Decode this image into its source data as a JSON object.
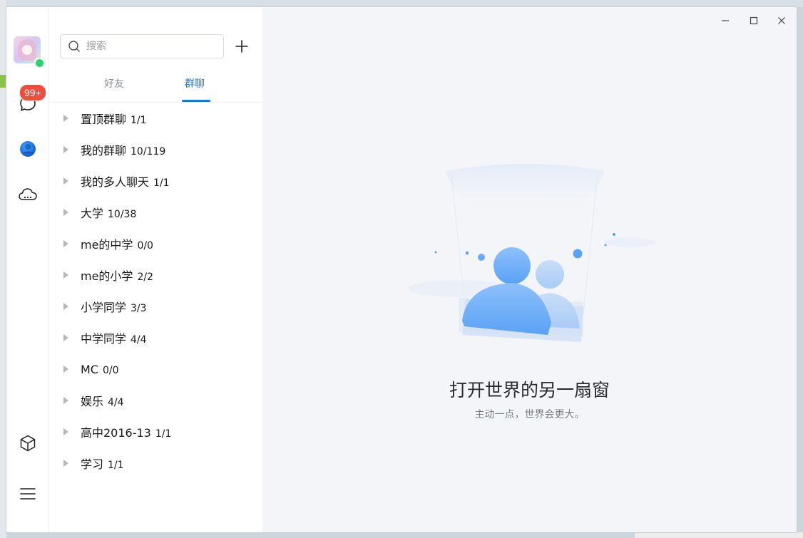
{
  "app": {
    "accent_color": "#1677e6",
    "badge_color": "#f04d3a",
    "online_color": "#2bd46b"
  },
  "rail": {
    "unread_badge": "99+",
    "icons": [
      "chat-bubble-icon",
      "contacts-icon",
      "cloud-icon",
      "cube-icon",
      "menu-icon"
    ]
  },
  "search": {
    "placeholder": "搜索"
  },
  "tabs": {
    "friends": "好友",
    "groups": "群聊",
    "active": "groups"
  },
  "groups": [
    {
      "name": "置顶群聊",
      "count": "1/1"
    },
    {
      "name": "我的群聊",
      "count": "10/119"
    },
    {
      "name": "我的多人聊天",
      "count": "1/1"
    },
    {
      "name": "大学",
      "count": "10/38"
    },
    {
      "name": "me的中学",
      "count": "0/0"
    },
    {
      "name": "me的小学",
      "count": "2/2"
    },
    {
      "name": "小学同学",
      "count": "3/3"
    },
    {
      "name": "中学同学",
      "count": "4/4"
    },
    {
      "name": "MC",
      "count": "0/0"
    },
    {
      "name": "娱乐",
      "count": "4/4"
    },
    {
      "name": "高中2016-13",
      "count": "1/1"
    },
    {
      "name": "学习",
      "count": "1/1"
    }
  ],
  "empty_state": {
    "title": "打开世界的另一扇窗",
    "subtitle": "主动一点，世界会更大。"
  }
}
